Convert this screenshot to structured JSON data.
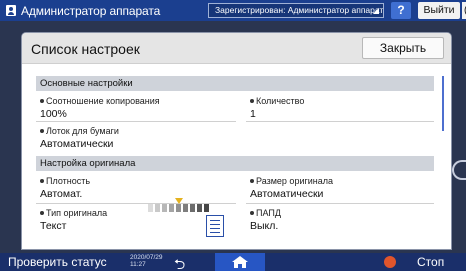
{
  "topbar": {
    "title": "Администратор аппарата",
    "login_status": "Зарегистрирован: Администратор аппарат",
    "help_label": "?",
    "logout_label": "Выйти",
    "edge_label": "("
  },
  "dialog": {
    "title": "Список настроек",
    "close_label": "Закрыть",
    "sections": [
      {
        "header": "Основные настройки",
        "items": [
          {
            "label": "Соотношение копирования",
            "value": "100%"
          },
          {
            "label": "Количество",
            "value": "1"
          },
          {
            "label": "Лоток для бумаги",
            "value": "Автоматически"
          }
        ]
      },
      {
        "header": "Настройка оригинала",
        "items": [
          {
            "label": "Плотность",
            "value": "Автомат."
          },
          {
            "label": "Размер оригинала",
            "value": "Автоматически"
          },
          {
            "label": "Тип оригинала",
            "value": "Текст"
          },
          {
            "label": "ПАПД",
            "value": "Выкл."
          }
        ]
      }
    ],
    "density_level": 5,
    "density_steps": 9
  },
  "bottombar": {
    "status_label": "Проверить статус",
    "date": "2020/07/29",
    "time": "11:27",
    "stop_label": "Стоп"
  },
  "colors": {
    "topbar": "#1b3f8f",
    "accent": "#2756c4",
    "section_header": "#cfd3da",
    "stop": "#e0552c",
    "density_marker": "#e4b21f"
  }
}
